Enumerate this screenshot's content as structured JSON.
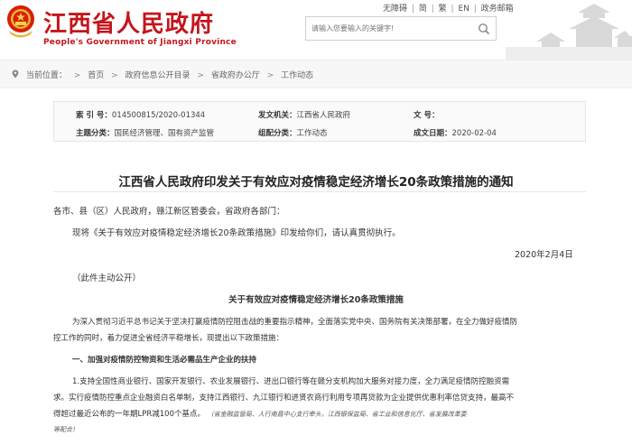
{
  "header": {
    "site_name": "江西省人民政府",
    "site_name_en": "People's Government of Jiangxi Province",
    "links": [
      "无障碍",
      "简",
      "繁",
      "EN",
      "政务邮箱"
    ],
    "search_placeholder": "请输入您要输入的关键字!",
    "brand_color": "#c4161c"
  },
  "breadcrumb": {
    "label": "当前位置：",
    "items": [
      "首页",
      "政府信息公开目录",
      "省政府办公厅",
      "工作动态"
    ]
  },
  "meta": {
    "index_label": "索 引 号：",
    "index_value": "014500815/2020-01344",
    "issuer_label": "发文机关：",
    "issuer_value": "江西省人民政府",
    "docno_label": "文 号：",
    "docno_value": "",
    "topic_label": "主题分类：",
    "topic_value": "国民经济管理、国有资产监管",
    "category_label": "组配分类：",
    "category_value": "工作动态",
    "date_label": "成文日期：",
    "date_value": "2020-02-04"
  },
  "article": {
    "title": "江西省人民政府印发关于有效应对疫情稳定经济增长20条政策措施的通知",
    "salutation": "各市、县（区）人民政府，赣江新区管委会，省政府各部门：",
    "body1": "现将《关于有效应对疫情稳定经济增长20条政策措施》印发给你们，请认真贯彻执行。",
    "date": "2020年2月4日",
    "public_note": "（此件主动公开）",
    "subtitle": "关于有效应对疫情稳定经济增长20条政策措施",
    "intro_line1": "为深入贯彻习近平总书记关于坚决打赢疫情防控阻击战的重要指示精神，全面落实党中央、国务院有关决策部署，在全力做好疫情防",
    "intro_line2": "控工作的同时，着力促进全省经济平稳增长，现提出以下政策措施：",
    "section1": "一、加强对疫情防控物资和生活必需品生产企业的扶持",
    "item1_line1": "1.支持全国性商业银行、国家开发银行、农业发展银行、进出口银行等在赣分支机构加大服务对接力度，全力满足疫情防控融资需",
    "item1_line2": "求。实行疫情防控重点企业融资白名单制，支持江西银行、九江银行和进贤农商行利用专项再贷款为企业提供优惠利率信贷支持，最高不",
    "item1_line3_a": "得超过最近公布的一年期LPR减100个基点。",
    "item1_line3_b": "（省金融监管局、人行南昌中心支行牵头，江西银保监局、省工业和信息化厅、省发展改革委",
    "item1_line4": "等配合）"
  }
}
